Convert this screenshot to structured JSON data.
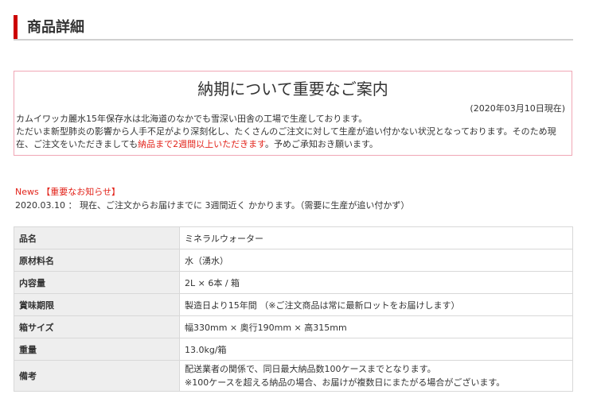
{
  "section": {
    "title": "商品詳細"
  },
  "notice": {
    "title": "納期について重要なご案内",
    "date": "(2020年03月10日現在)",
    "line1": "カムイワッカ麗水15年保存水は北海道のなかでも雪深い田舎の工場で生産しております。",
    "line2": "ただいま新型肺炎の影響から人手不足がより深刻化し、たくさんのご注文に対して生産が追い付かない状況となっております。そのため現在、ご注文をいただきましても",
    "highlight": "納品まで2週間以上いただきます",
    "line2_end": "。予めご承知おき願います。"
  },
  "news": {
    "title": "News 【重要なお知らせ】",
    "line": "2020.03.10 ： 現在、ご注文からお届けまでに 3週間近く かかります。（需要に生産が追い付かず）"
  },
  "spec_table": {
    "rows": [
      {
        "label": "品名",
        "value": "ミネラルウォーター"
      },
      {
        "label": "原材料名",
        "value": "水（湧水）"
      },
      {
        "label": "内容量",
        "value": "2L × 6本 / 箱"
      },
      {
        "label": "賞味期限",
        "value": "製造日より15年間 （※ご注文商品は常に最新ロットをお届けします）"
      },
      {
        "label": "箱サイズ",
        "value": "幅330mm × 奥行190mm × 高315mm"
      },
      {
        "label": "重量",
        "value": "13.0kg/箱"
      },
      {
        "label": "備考",
        "value": "配送業者の関係で、同日最大納品数100ケースまでとなります。",
        "value2": "※100ケースを超える納品の場合、お届けが複数日にまたがる場合がございます。"
      }
    ]
  }
}
